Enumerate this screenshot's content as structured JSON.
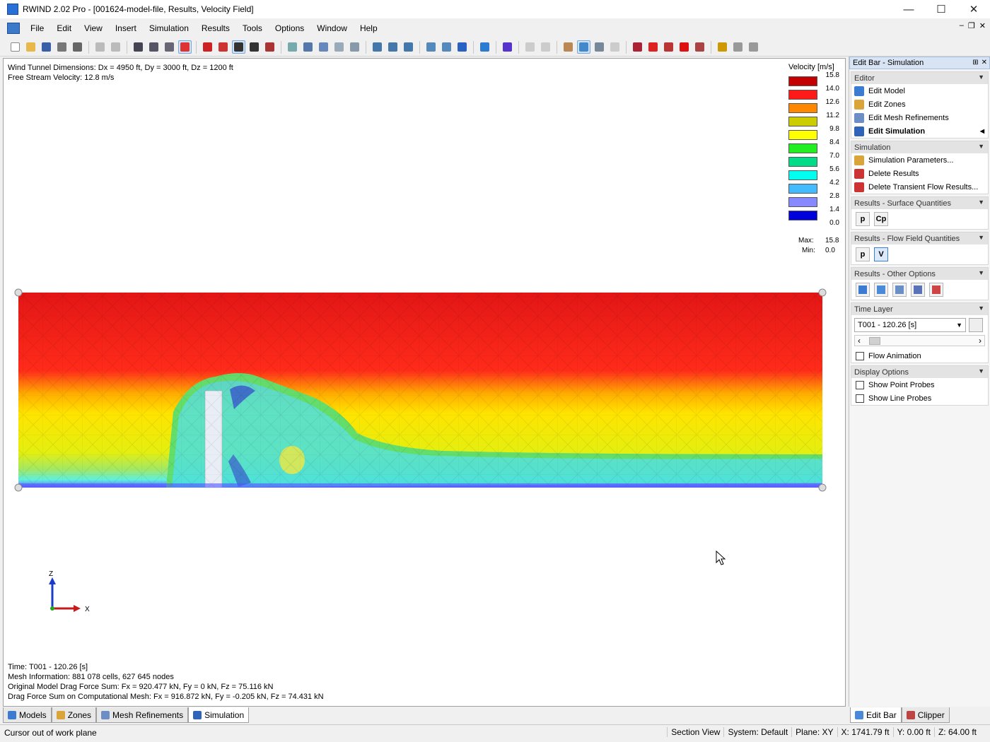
{
  "window": {
    "title": "RWIND 2.02 Pro - [001624-model-file, Results, Velocity Field]",
    "minimize": "—",
    "maximize": "☐",
    "close": "✕"
  },
  "menu": [
    "File",
    "Edit",
    "View",
    "Insert",
    "Simulation",
    "Results",
    "Tools",
    "Options",
    "Window",
    "Help"
  ],
  "viewport": {
    "info_top": [
      "Wind Tunnel Dimensions: Dx = 4950 ft, Dy = 3000 ft, Dz = 1200 ft",
      "Free Stream Velocity: 12.8 m/s"
    ],
    "info_bottom": [
      "Time: T001 - 120.26 [s]",
      "Mesh Information: 881 078 cells, 627 645 nodes",
      "Original Model Drag Force Sum: Fx = 920.477 kN, Fy = 0 kN, Fz = 75.116 kN",
      "Drag Force Sum on Computational Mesh: Fx = 916.872 kN, Fy = -0.205 kN, Fz = 74.431 kN"
    ],
    "axis": {
      "z": "Z",
      "x": "X"
    }
  },
  "legend": {
    "title": "Velocity [m/s]",
    "values": [
      "15.8",
      "14.0",
      "12.6",
      "11.2",
      "9.8",
      "8.4",
      "7.0",
      "5.6",
      "4.2",
      "2.8",
      "1.4",
      "0.0"
    ],
    "colors": [
      "#c40000",
      "#ff1a1a",
      "#ff8800",
      "#cccc00",
      "#ffff00",
      "#22ee22",
      "#00dd88",
      "#00ffee",
      "#44bbff",
      "#8888ff",
      "#0000dd"
    ],
    "max_label": "Max:",
    "max_value": "15.8",
    "min_label": "Min:",
    "min_value": "0.0"
  },
  "bottom_tabs": [
    "Models",
    "Zones",
    "Mesh Refinements",
    "Simulation"
  ],
  "right_tabs": [
    "Edit Bar",
    "Clipper"
  ],
  "status": {
    "message": "Cursor out of work plane",
    "items": [
      "Section View",
      "System: Default",
      "Plane: XY",
      "X: 1741.79 ft",
      "Y: 0.00 ft",
      "Z: 64.00 ft"
    ]
  },
  "panel": {
    "title": "Edit Bar - Simulation",
    "editor": {
      "title": "Editor",
      "items": [
        "Edit Model",
        "Edit Zones",
        "Edit Mesh Refinements",
        "Edit Simulation"
      ]
    },
    "simulation": {
      "title": "Simulation",
      "items": [
        "Simulation Parameters...",
        "Delete Results",
        "Delete Transient Flow Results..."
      ]
    },
    "surface": {
      "title": "Results - Surface Quantities",
      "buttons": [
        "p",
        "Cp"
      ]
    },
    "flow": {
      "title": "Results - Flow Field Quantities",
      "buttons": [
        "p",
        "V"
      ]
    },
    "other": {
      "title": "Results - Other Options"
    },
    "time_layer": {
      "title": "Time Layer",
      "value": "T001 - 120.26 [s]",
      "animation": "Flow Animation"
    },
    "display": {
      "title": "Display Options",
      "items": [
        "Show Point Probes",
        "Show Line Probes"
      ]
    }
  }
}
